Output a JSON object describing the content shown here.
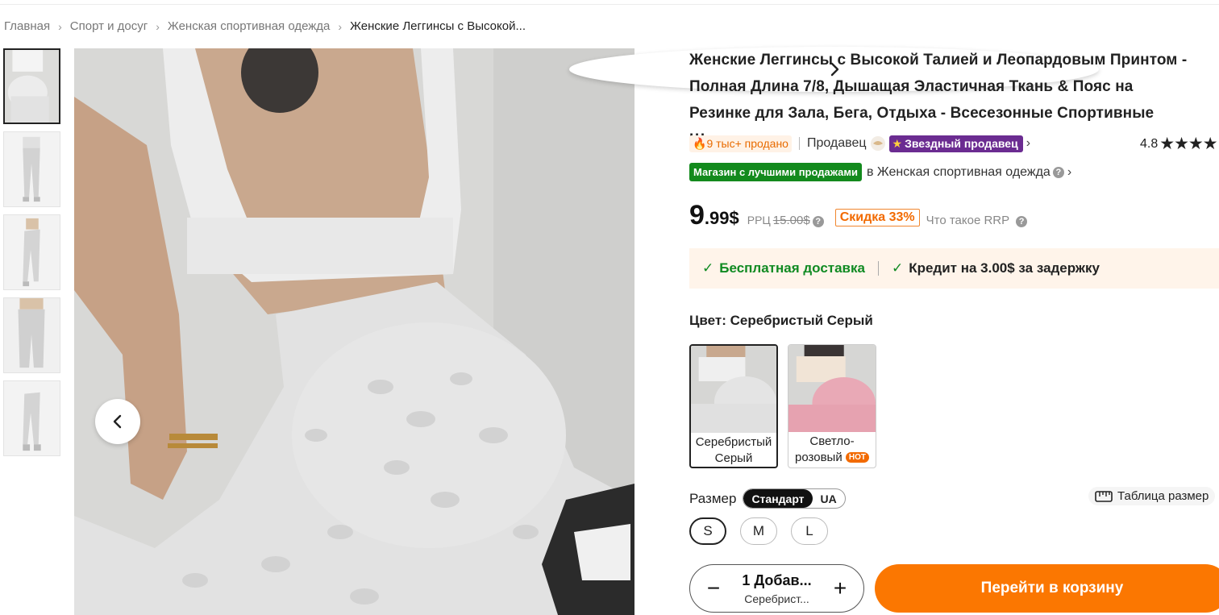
{
  "breadcrumb": {
    "items": [
      "Главная",
      "Спорт и досуг",
      "Женская спортивная одежда"
    ],
    "current": "Женские Леггинсы с Высокой..."
  },
  "gallery": {
    "thumb_count": 5,
    "main_image_icon": "leggings-photo"
  },
  "product": {
    "title": "Женские Леггинсы с Высокой Талией и Леопардовым Принтом - Полная Длина 7/8, Дышащая Эластичная Ткань & Пояс на Резинке для Зала, Бега, Отдыха - Всесезонные Спортивные Штаны",
    "sold": "9 тыс+ продано",
    "seller_label": "Продавец",
    "star_seller": "Звездный продавец",
    "rating": "4.8",
    "stars": "★★★★",
    "best_badge": "Магазин с лучшими продажами",
    "best_category": "в Женская спортивная одежда"
  },
  "price": {
    "int": "9",
    "dec": ".99$",
    "rrp_label": "РРЦ",
    "rrp_value": "15.00$",
    "discount": "Скидка 33%",
    "what_rrp": "Что такое RRP"
  },
  "shipping": {
    "free": "Бесплатная доставка",
    "credit": "Кредит на 3.00$ за задержку"
  },
  "color": {
    "label": "Цвет:",
    "selected": "Серебристый Серый",
    "options": [
      {
        "label": "Серебристый Серый",
        "hot": ""
      },
      {
        "label": "Светло-розовый",
        "hot": "HOT"
      }
    ]
  },
  "size": {
    "label": "Размер",
    "standards": [
      "Стандарт",
      "UA"
    ],
    "table": "Таблица размер",
    "options": [
      "S",
      "M",
      "L"
    ]
  },
  "cart": {
    "qty_line1": "1 Добав...",
    "qty_line2": "Серебрист...",
    "minus": "−",
    "plus": "+",
    "button": "Перейти в корзину"
  },
  "colors": {
    "accent": "#fb7701",
    "green": "#108a22",
    "purple": "#6b2c91"
  }
}
